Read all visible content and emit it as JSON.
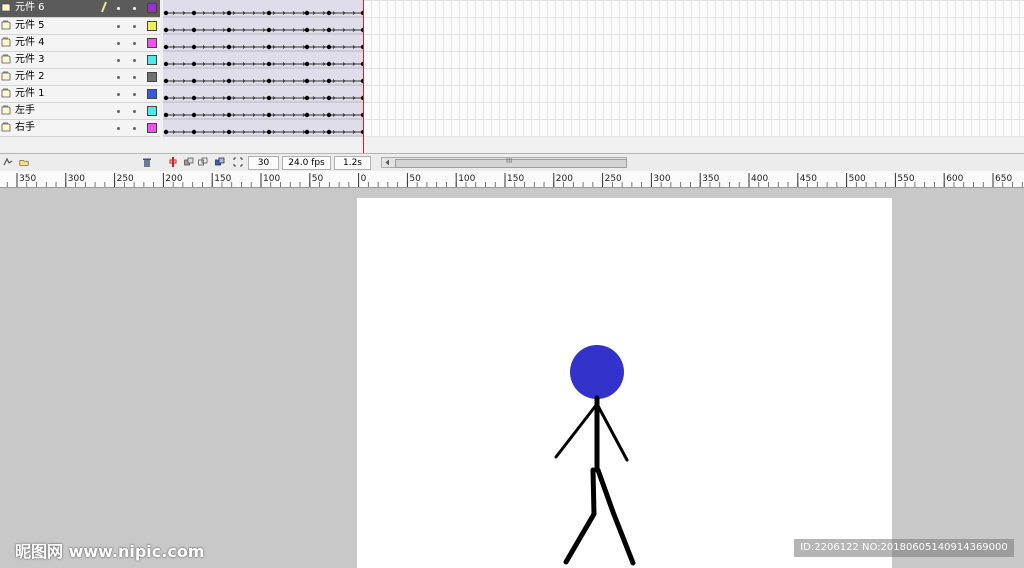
{
  "layers": [
    {
      "name": "元件 6",
      "color": "#9b30c8",
      "selected": true
    },
    {
      "name": "元件 5",
      "color": "#f0f05a"
    },
    {
      "name": "元件 4",
      "color": "#f050f0"
    },
    {
      "name": "元件 3",
      "color": "#50e8e8"
    },
    {
      "name": "元件 2",
      "color": "#707070"
    },
    {
      "name": "元件 1",
      "color": "#3c5ae0"
    },
    {
      "name": "左手",
      "color": "#50e8e8"
    },
    {
      "name": "右手",
      "color": "#f050f0"
    }
  ],
  "timeline_footer": {
    "current_frame": "30",
    "frame_rate": "24.0 fps",
    "elapsed_time": "1.2s",
    "scroll_grip": "III"
  },
  "ruler": {
    "labels": [
      "350",
      "300",
      "250",
      "200",
      "150",
      "100",
      "50",
      "0",
      "50",
      "100",
      "150",
      "200",
      "250",
      "300",
      "350",
      "400",
      "450",
      "500",
      "550",
      "600",
      "650"
    ]
  },
  "stage": {
    "head_color": "#3333cc"
  },
  "watermark": {
    "text": "昵图网 www.nipic.com"
  },
  "image_id": {
    "text": "ID:2206122 NO:20180605140914369000"
  }
}
